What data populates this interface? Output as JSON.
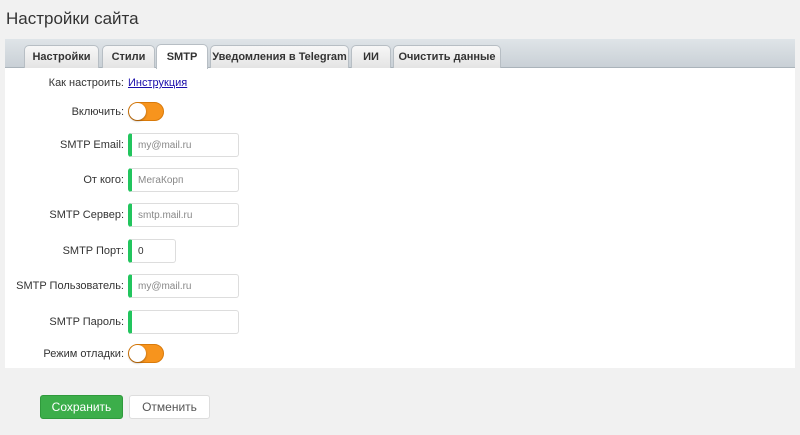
{
  "page": {
    "title": "Настройки сайта"
  },
  "tabs": [
    {
      "label": "Настройки"
    },
    {
      "label": "Стили"
    },
    {
      "label": "SMTP",
      "active": true
    },
    {
      "label": "Уведомления в Telegram"
    },
    {
      "label": "ИИ"
    },
    {
      "label": "Очистить данные"
    }
  ],
  "form": {
    "how_to_label": "Как настроить:",
    "how_to_link": "Инструкция",
    "enable_label": "Включить:",
    "enable_state": "off",
    "smtp_email": {
      "label": "SMTP Email:",
      "value": "",
      "placeholder": "my@mail.ru"
    },
    "from_name": {
      "label": "От кого:",
      "value": "",
      "placeholder": "МегаКорп"
    },
    "smtp_server": {
      "label": "SMTP Сервер:",
      "value": "",
      "placeholder": "smtp.mail.ru"
    },
    "smtp_port": {
      "label": "SMTP Порт:",
      "value": "0",
      "placeholder": ""
    },
    "smtp_user": {
      "label": "SMTP Пользователь:",
      "value": "",
      "placeholder": "my@mail.ru"
    },
    "smtp_password": {
      "label": "SMTP Пароль:",
      "value": "",
      "placeholder": ""
    },
    "debug_label": "Режим отладки:",
    "debug_state": "off"
  },
  "actions": {
    "save_label": "Сохранить",
    "cancel_label": "Отменить"
  },
  "colors": {
    "accent_green": "#3cae4a",
    "field_marker": "#22c55e",
    "toggle_orange": "#f7941d",
    "link": "#1a0dab"
  }
}
